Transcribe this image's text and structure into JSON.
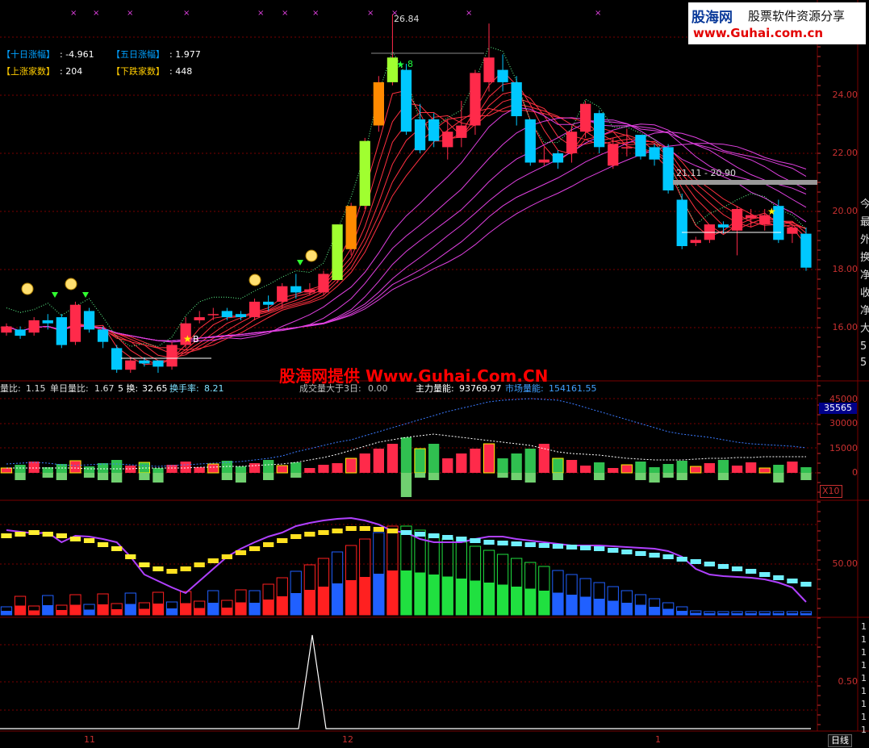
{
  "header_stats": [
    {
      "label": "【十日涨幅】",
      "value": ": -4.961"
    },
    {
      "label": "【五日涨幅】",
      "value": ": 1.977"
    },
    {
      "label": "【上涨家数】",
      "value": ": 204"
    },
    {
      "label": "【下跌家数】",
      "value": ": 448"
    }
  ],
  "price_annotations": {
    "high": "26.84",
    "range": "21.11 - 20.90",
    "buy_mark": "B",
    "star_mark": "8"
  },
  "price_axis": [
    "24.00",
    "22.00",
    "20.00",
    "18.00",
    "16.00"
  ],
  "right_edge_chars": [
    "今",
    "最",
    "外",
    "换",
    "净",
    "收",
    "净",
    "大",
    "5",
    "5"
  ],
  "watermark": {
    "title": "股海网提供 Www.Guhai.Com.CN"
  },
  "logo": {
    "line1": "股海网",
    "line1b": "股票软件资源分享",
    "line2": "www.Guhai.com.cn"
  },
  "volume_panel": {
    "items": [
      {
        "label": "量比: ",
        "value": "1.15"
      },
      {
        "label": "单日量比: ",
        "value": "1.67"
      },
      {
        "label": "5 换: ",
        "value": "32.65"
      },
      {
        "label": "换手率: ",
        "value": "8.21"
      },
      {
        "label": "成交量大于3日: ",
        "value": "0.00"
      },
      {
        "label": "主力量能: ",
        "value": "93769.97"
      },
      {
        "label": "市场量能: ",
        "value": "154161.55"
      }
    ],
    "axis": [
      "45000",
      "30000",
      "15000",
      "0"
    ],
    "badge": "35565",
    "multiplier": "X10"
  },
  "indicator_panel": {
    "axis": [
      "50.00"
    ]
  },
  "signal_panel": {
    "axis": [
      "0.50"
    ],
    "right_digits": [
      "1",
      "1",
      "1",
      "1",
      "1",
      "1",
      "1",
      "1",
      "1"
    ]
  },
  "time_axis": {
    "labels": [
      "11",
      "12",
      "1"
    ],
    "period_button": "日线"
  },
  "colors": {
    "up": "#ff2a4a",
    "down": "#00c8ff",
    "axis": "#c83030",
    "grid": "#7a0000",
    "ma_red": "#ff3040",
    "ma_magenta": "#e040e0"
  },
  "chart_data": {
    "type": "candlestick",
    "ylim": [
      15.2,
      27.0
    ],
    "candles": [
      [
        16.5,
        16.7,
        16.4,
        16.8
      ],
      [
        16.6,
        16.4,
        16.3,
        16.7
      ],
      [
        16.5,
        16.9,
        16.4,
        17.0
      ],
      [
        16.9,
        16.8,
        16.6,
        17.1
      ],
      [
        17.0,
        16.1,
        16.0,
        17.1
      ],
      [
        16.2,
        17.4,
        16.1,
        17.5
      ],
      [
        17.2,
        16.6,
        16.5,
        17.3
      ],
      [
        16.6,
        16.2,
        16.0,
        16.7
      ],
      [
        16.0,
        15.3,
        15.2,
        16.1
      ],
      [
        15.3,
        15.6,
        15.2,
        15.7
      ],
      [
        15.6,
        15.5,
        15.4,
        15.7
      ],
      [
        15.6,
        15.4,
        15.2,
        15.6
      ],
      [
        15.4,
        16.1,
        15.3,
        16.2
      ],
      [
        16.1,
        16.8,
        16.0,
        17.0
      ],
      [
        16.9,
        17.0,
        16.8,
        17.2
      ],
      [
        17.1,
        17.1,
        16.9,
        17.3
      ],
      [
        17.2,
        17.0,
        16.9,
        17.3
      ],
      [
        17.1,
        17.0,
        16.9,
        17.2
      ],
      [
        17.0,
        17.5,
        16.9,
        17.6
      ],
      [
        17.5,
        17.4,
        17.2,
        17.7
      ],
      [
        17.5,
        18.0,
        17.3,
        18.1
      ],
      [
        18.0,
        17.8,
        17.6,
        18.4
      ],
      [
        17.8,
        17.9,
        17.7,
        18.1
      ],
      [
        17.8,
        18.4,
        17.7,
        18.5
      ],
      [
        18.2,
        20.0,
        18.1,
        20.0
      ],
      [
        19.2,
        20.6,
        19.0,
        20.7
      ],
      [
        20.6,
        22.7,
        20.5,
        22.8
      ],
      [
        23.2,
        24.6,
        23.0,
        24.8
      ],
      [
        24.6,
        25.4,
        24.5,
        26.8
      ],
      [
        25.0,
        23.0,
        22.9,
        25.2
      ],
      [
        23.4,
        22.4,
        22.3,
        23.9
      ],
      [
        23.4,
        22.7,
        22.5,
        23.6
      ],
      [
        22.5,
        23.0,
        22.1,
        23.4
      ],
      [
        22.8,
        23.2,
        22.5,
        24.0
      ],
      [
        23.2,
        24.9,
        22.9,
        25.0
      ],
      [
        24.6,
        25.4,
        24.3,
        26.5
      ],
      [
        25.0,
        24.6,
        24.3,
        25.5
      ],
      [
        24.6,
        23.5,
        23.2,
        24.8
      ],
      [
        23.4,
        22.0,
        21.9,
        23.4
      ],
      [
        22.0,
        22.1,
        21.9,
        22.5
      ],
      [
        22.3,
        22.0,
        21.8,
        22.4
      ],
      [
        22.3,
        23.0,
        22.0,
        23.2
      ],
      [
        23.0,
        23.9,
        22.8,
        24.0
      ],
      [
        23.6,
        22.5,
        22.3,
        23.7
      ],
      [
        21.9,
        22.6,
        21.8,
        22.8
      ],
      [
        22.5,
        22.5,
        22.2,
        23.1
      ],
      [
        22.9,
        22.2,
        22.1,
        22.9
      ],
      [
        22.5,
        22.1,
        21.9,
        22.6
      ],
      [
        22.5,
        21.1,
        21.0,
        22.6
      ],
      [
        20.8,
        19.3,
        19.2,
        21.0
      ],
      [
        19.4,
        19.5,
        19.3,
        19.6
      ],
      [
        19.5,
        20.0,
        19.4,
        20.0
      ],
      [
        20.0,
        19.9,
        19.7,
        20.1
      ],
      [
        19.8,
        20.5,
        19.0,
        20.6
      ],
      [
        20.2,
        20.3,
        19.9,
        20.5
      ],
      [
        20.0,
        20.3,
        19.8,
        20.5
      ],
      [
        20.6,
        19.5,
        19.4,
        20.8
      ],
      [
        19.7,
        19.9,
        19.4,
        20.0
      ],
      [
        19.7,
        18.6,
        18.5,
        19.9
      ]
    ]
  }
}
